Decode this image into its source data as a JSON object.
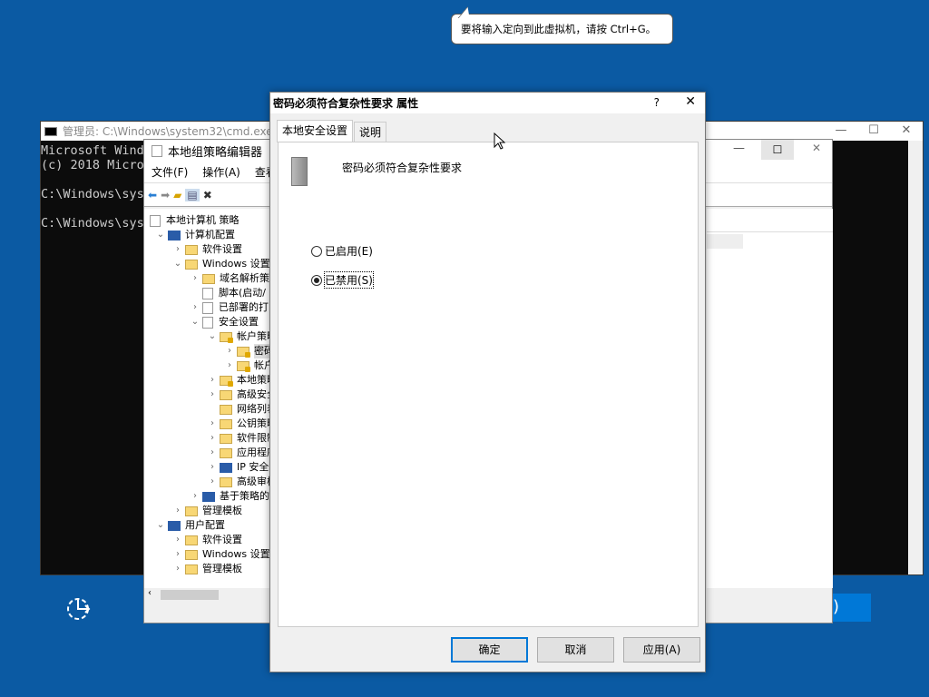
{
  "tooltip": "要将输入定向到此虚拟机，请按 Ctrl+G。",
  "cmd": {
    "title": "管理员: C:\\Windows\\system32\\cmd.exe",
    "lines": [
      "Microsoft Wind",
      "(c) 2018 Micro",
      "",
      "C:\\Windows\\sys",
      "",
      "C:\\Windows\\sys"
    ]
  },
  "gpedit": {
    "title": "本地组策略编辑器",
    "menu": [
      "文件(F)",
      "操作(A)",
      "查看"
    ],
    "tree": [
      {
        "label": "本地计算机 策略",
        "level": 0,
        "chev": "",
        "icon": "doc"
      },
      {
        "label": "计算机配置",
        "level": 1,
        "chev": "down",
        "icon": "computer"
      },
      {
        "label": "软件设置",
        "level": 2,
        "chev": "right",
        "icon": "folder"
      },
      {
        "label": "Windows 设置",
        "level": 2,
        "chev": "down",
        "icon": "folder"
      },
      {
        "label": "域名解析策",
        "level": 3,
        "chev": "right",
        "icon": "folder"
      },
      {
        "label": "脚本(启动/",
        "level": 3,
        "chev": "",
        "icon": "doc"
      },
      {
        "label": "已部署的打",
        "level": 3,
        "chev": "right",
        "icon": "printer"
      },
      {
        "label": "安全设置",
        "level": 3,
        "chev": "down",
        "icon": "security"
      },
      {
        "label": "帐户策略",
        "level": 4,
        "chev": "down",
        "icon": "folder-lock"
      },
      {
        "label": "密码",
        "level": 5,
        "chev": "right",
        "icon": "folder-lock",
        "selected": true
      },
      {
        "label": "帐户",
        "level": 5,
        "chev": "right",
        "icon": "folder-lock"
      },
      {
        "label": "本地策略",
        "level": 4,
        "chev": "right",
        "icon": "folder-lock"
      },
      {
        "label": "高级安全",
        "level": 4,
        "chev": "right",
        "icon": "folder"
      },
      {
        "label": "网络列表",
        "level": 4,
        "chev": "",
        "icon": "folder"
      },
      {
        "label": "公钥策略",
        "level": 4,
        "chev": "right",
        "icon": "folder"
      },
      {
        "label": "软件限制",
        "level": 4,
        "chev": "right",
        "icon": "folder"
      },
      {
        "label": "应用程序",
        "level": 4,
        "chev": "right",
        "icon": "folder"
      },
      {
        "label": "IP 安全",
        "level": 4,
        "chev": "right",
        "icon": "computer"
      },
      {
        "label": "高级审核",
        "level": 4,
        "chev": "right",
        "icon": "folder"
      },
      {
        "label": "基于策略的",
        "level": 3,
        "chev": "right",
        "icon": "chart"
      },
      {
        "label": "管理模板",
        "level": 2,
        "chev": "right",
        "icon": "folder"
      },
      {
        "label": "用户配置",
        "level": 1,
        "chev": "down",
        "icon": "user"
      },
      {
        "label": "软件设置",
        "level": 2,
        "chev": "right",
        "icon": "folder"
      },
      {
        "label": "Windows 设置",
        "level": 2,
        "chev": "right",
        "icon": "folder"
      },
      {
        "label": "管理模板",
        "level": 2,
        "chev": "right",
        "icon": "folder"
      }
    ]
  },
  "dialog": {
    "title": "密码必须符合复杂性要求 属性",
    "help": "?",
    "tabs": [
      "本地安全设置",
      "说明"
    ],
    "policy_name": "密码必须符合复杂性要求",
    "options": [
      {
        "label": "已启用(E)",
        "checked": false
      },
      {
        "label": "已禁用(S)",
        "checked": true
      }
    ],
    "buttons": {
      "ok": "确定",
      "cancel": "取消",
      "apply": "应用(A)"
    }
  },
  "partial_button_text": ")"
}
